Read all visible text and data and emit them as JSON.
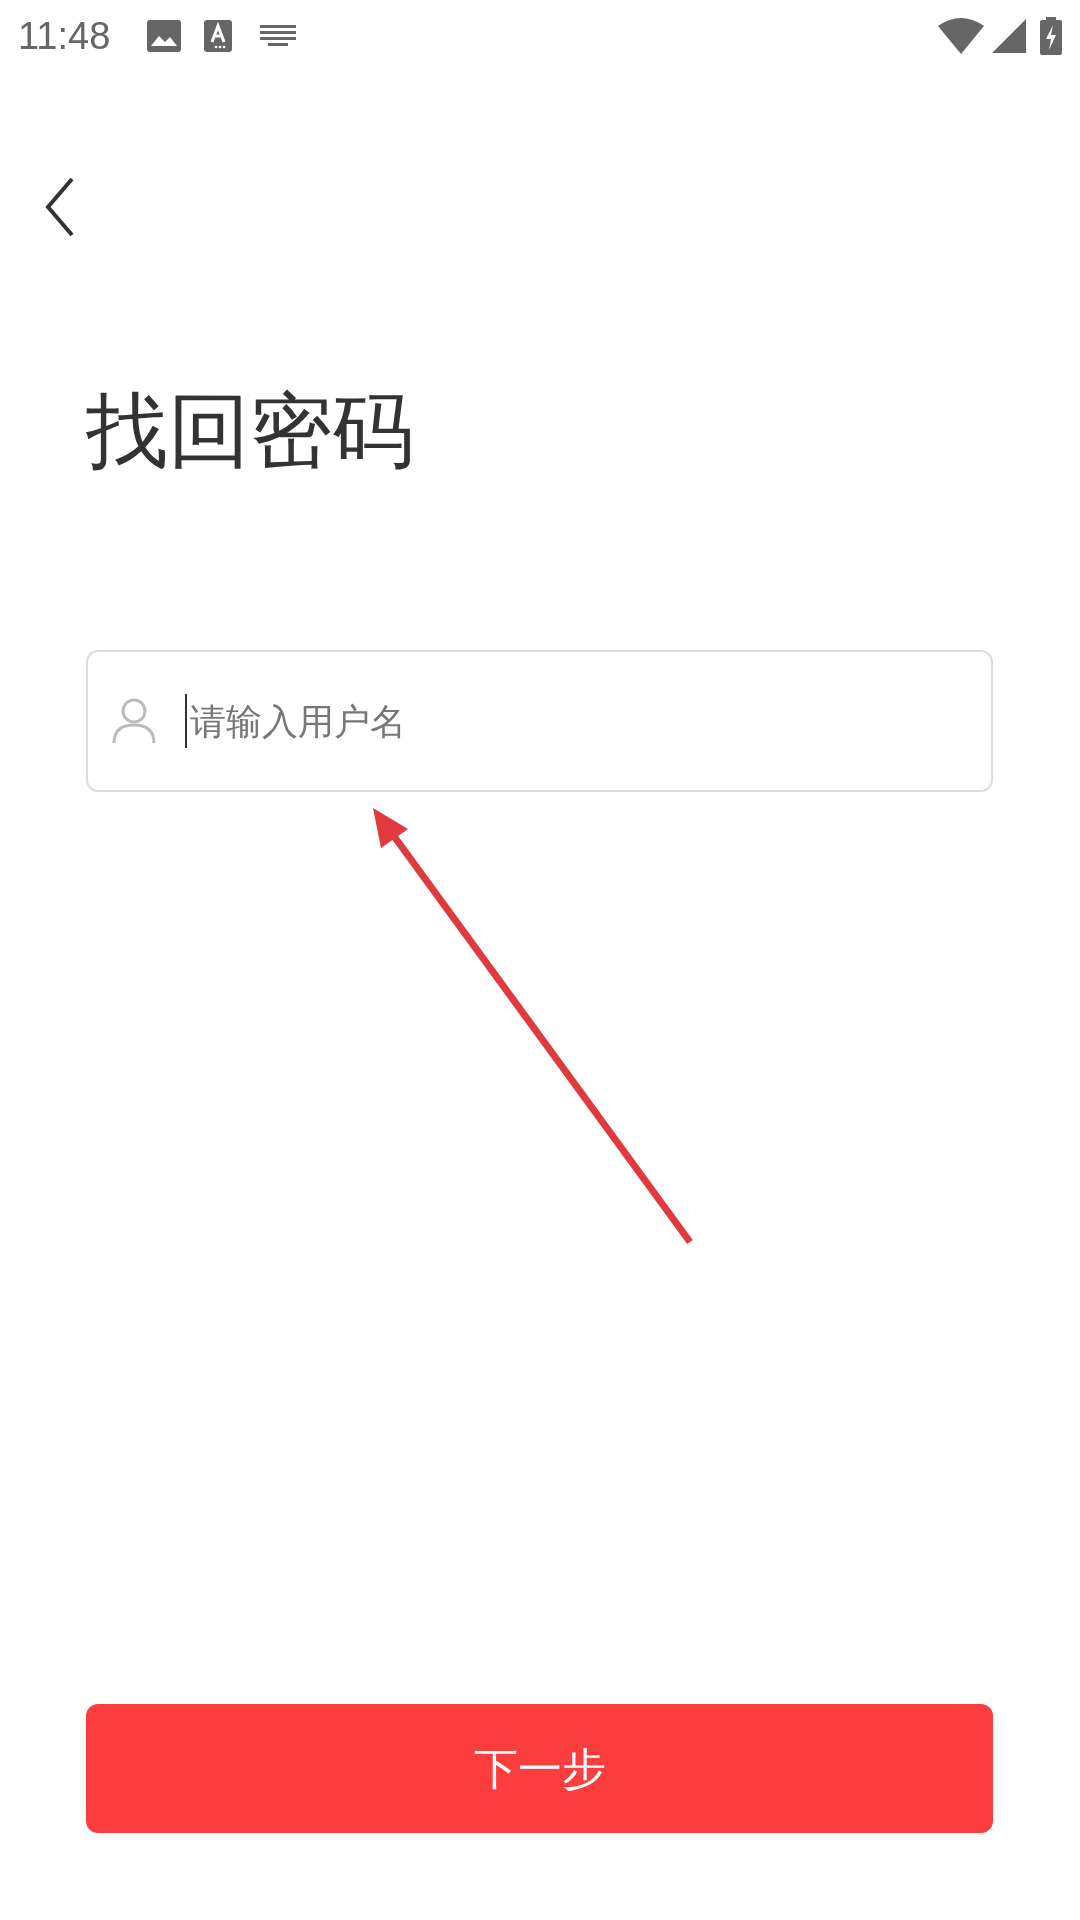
{
  "status_bar": {
    "time": "11:48"
  },
  "title": "找回密码",
  "username_field": {
    "placeholder": "请输入用户名",
    "focused": true
  },
  "next_button": {
    "label": "下一步"
  },
  "annotation": {
    "kind": "arrow"
  }
}
